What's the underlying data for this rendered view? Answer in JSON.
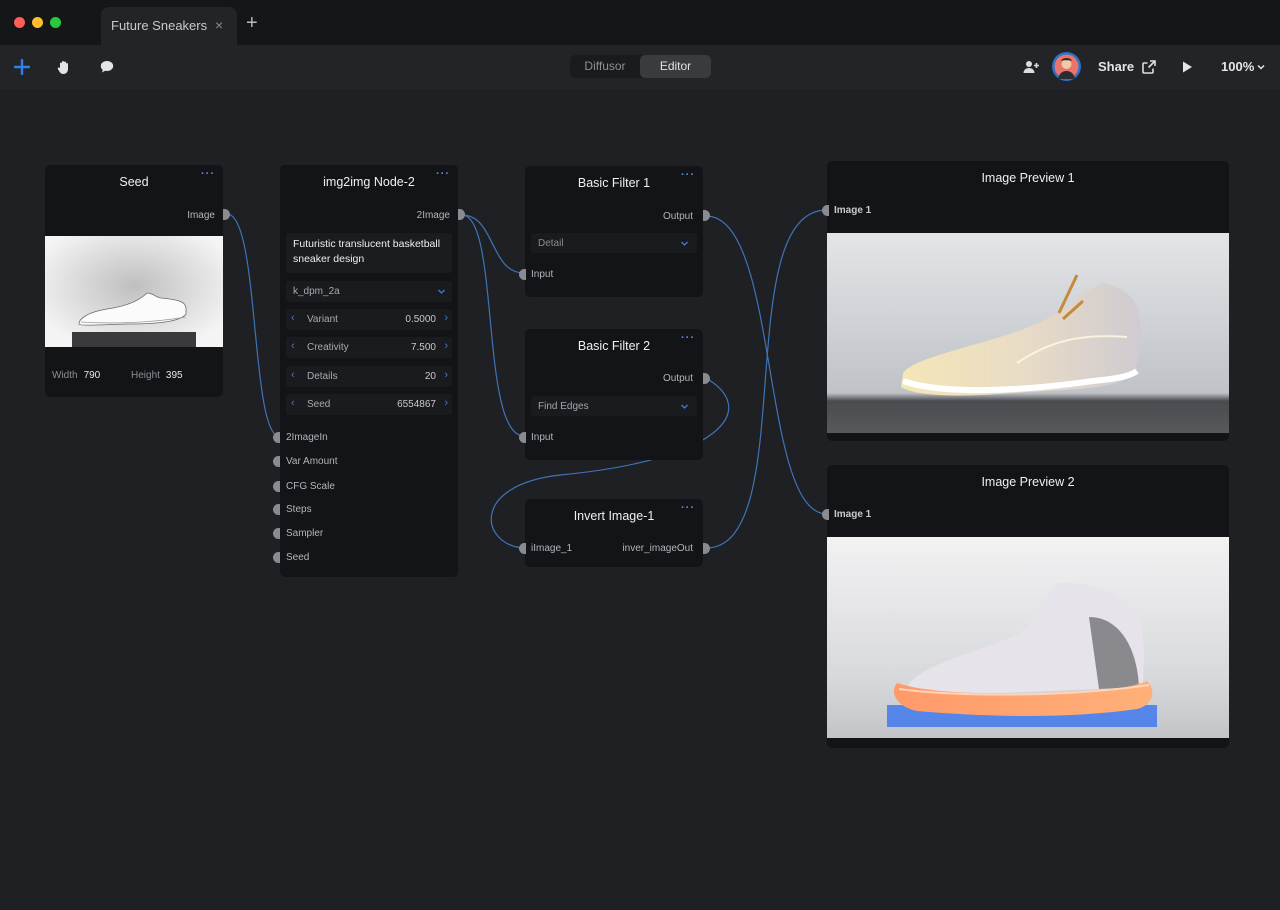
{
  "window": {
    "tab_title": "Future Sneakers",
    "tab_close": "×",
    "tab_add": "+"
  },
  "toolbar": {
    "tools": [
      "plus-icon",
      "hand-icon",
      "comment-icon"
    ],
    "modes": [
      "Diffusor",
      "Editor"
    ],
    "active_mode": "Editor",
    "share_label": "Share",
    "zoom_label": "100%"
  },
  "colors": {
    "accent": "#2f80ed",
    "wire": "#3f73b8",
    "node_bg": "#131417",
    "canvas_bg": "#1f2023"
  },
  "nodes": {
    "seed": {
      "title": "Seed",
      "menu": "···",
      "output": "Image",
      "width_label": "Width",
      "width_value": "790",
      "height_label": "Height",
      "height_value": "395"
    },
    "img2img": {
      "title": "img2img Node-2",
      "menu": "···",
      "output": "2Image",
      "prompt": "Futuristic translucent basketball sneaker design",
      "sampler": "k_dpm_2a",
      "params": [
        {
          "label": "Variant",
          "value": "0.5000"
        },
        {
          "label": "Creativity",
          "value": "7.500"
        },
        {
          "label": "Details",
          "value": "20"
        },
        {
          "label": "Seed",
          "value": "6554867"
        }
      ],
      "inputs": [
        "2ImageIn",
        "Var Amount",
        "CFG Scale",
        "Steps",
        "Sampler",
        "Seed"
      ]
    },
    "filter1": {
      "title": "Basic Filter 1",
      "menu": "···",
      "output": "Output",
      "select": "Detail",
      "input": "Input"
    },
    "filter2": {
      "title": "Basic Filter 2",
      "menu": "···",
      "output": "Output",
      "select": "Find Edges",
      "input": "Input"
    },
    "invert": {
      "title": "Invert Image-1",
      "menu": "···",
      "input": "iImage_1",
      "output": "inver_imageOut"
    },
    "preview1": {
      "title": "Image Preview 1",
      "input": "Image 1"
    },
    "preview2": {
      "title": "Image Preview 2",
      "input": "Image 1"
    }
  }
}
